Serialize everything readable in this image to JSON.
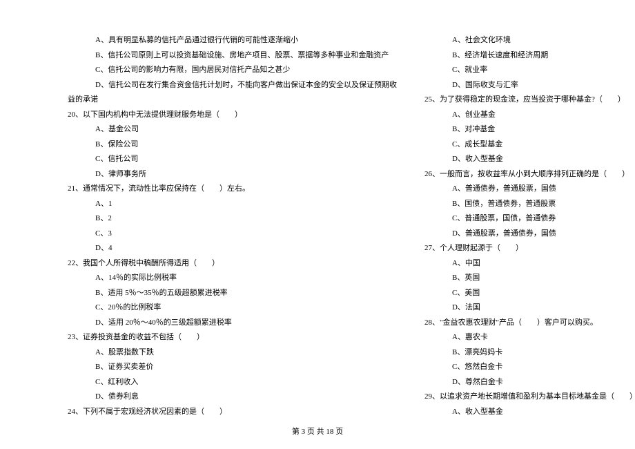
{
  "left": {
    "l0": "A、具有明显私募的信托产品通过银行代销的可能性逐渐缩小",
    "l1": "B、信托公司原则上可以投资基础设施、房地产项目、股票、票据等多种事业和金融资产",
    "l2": "C、信托公司的影响力有限，国内居民对信托产品知之甚少",
    "l3": "D、信托公司在发行集合资金信托计划时，不能向客户做出保证本金的安全以及保证预期收",
    "l4": "益的承诺",
    "q20": "20、以下国内机构中无法提供理财服务地是（　　）",
    "q20a": "A、基金公司",
    "q20b": "B、保险公司",
    "q20c": "C、信托公司",
    "q20d": "D、律师事务所",
    "q21": "21、通常情况下，流动性比率应保持在（　　）左右。",
    "q21a": "A、1",
    "q21b": "B、2",
    "q21c": "C、3",
    "q21d": "D、4",
    "q22": "22、我国个人所得税中稿酬所得适用（　　）",
    "q22a": "A、14％的实际比例税率",
    "q22b": "B、适用 5％～35％的五级超额累进税率",
    "q22c": "C、20％的比例税率",
    "q22d": "D、适用 20％～40％的三级超额累进税率",
    "q23": "23、证券投资基金的收益不包括（　　）",
    "q23a": "A、股票指数下跌",
    "q23b": "B、证券买卖差价",
    "q23c": "C、红利收入",
    "q23d": "D、债券利息",
    "q24": "24、下列不属于宏观经济状况因素的是（　　）"
  },
  "right": {
    "r0": "A、社会文化环境",
    "r1": "B、经济增长速度和经济周期",
    "r2": "C、就业率",
    "r3": "D、国际收支与汇率",
    "q25": "25、为了获得稳定的现金流，应当投资于哪种基金?（　　）",
    "q25a": "A、创业基金",
    "q25b": "B、对冲基金",
    "q25c": "C、成长型基金",
    "q25d": "D、收入型基金",
    "q26": "26、一般而言，按收益率从小到大顺序排列正确的是（　　）",
    "q26a": "A、普通债券，普通股票，国债",
    "q26b": "B、国债，普通债券，普通股票",
    "q26c": "C、普通股票，国债，普通债券",
    "q26d": "D、普通股票，普通债券，国债",
    "q27": "27、个人理财起源于（　　）",
    "q27a": "A、中国",
    "q27b": "B、英国",
    "q27c": "C、美国",
    "q27d": "D、法国",
    "q28": "28、\"金益农惠农理财\"产品（　　）客户可以购买。",
    "q28a": "A、惠农卡",
    "q28b": "B、漂亮妈妈卡",
    "q28c": "C、悠然白金卡",
    "q28d": "D、尊然白金卡",
    "q29": "29、以追求资产地长期增值和盈利为基本目标地基金是（　　）",
    "q29a": "A、收入型基金"
  },
  "footer": "第 3 页 共 18 页"
}
